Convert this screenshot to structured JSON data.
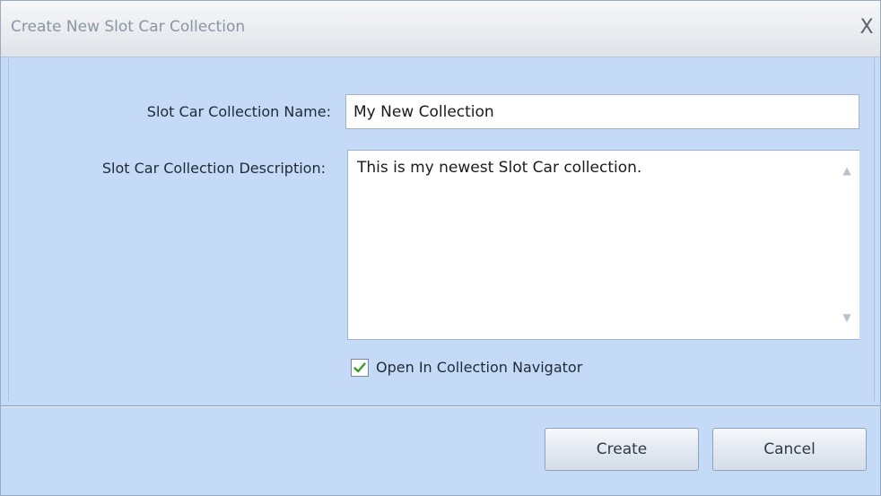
{
  "window": {
    "title": "Create New Slot Car Collection",
    "close_glyph": "X"
  },
  "form": {
    "name_label": "Slot Car Collection Name:",
    "name_value": "My New Collection",
    "description_label": "Slot Car Collection Description:",
    "description_value": "This is my newest Slot Car collection.",
    "open_navigator_label": "Open In Collection Navigator",
    "open_navigator_checked": true
  },
  "buttons": {
    "create_label": "Create",
    "cancel_label": "Cancel"
  },
  "icons": {
    "close": "close-icon",
    "checkmark": "checkmark-icon",
    "scroll_up": "chevron-up-icon",
    "scroll_down": "chevron-down-icon"
  },
  "colors": {
    "panel_background": "#c4daf6",
    "check_green": "#3a9a2a"
  }
}
